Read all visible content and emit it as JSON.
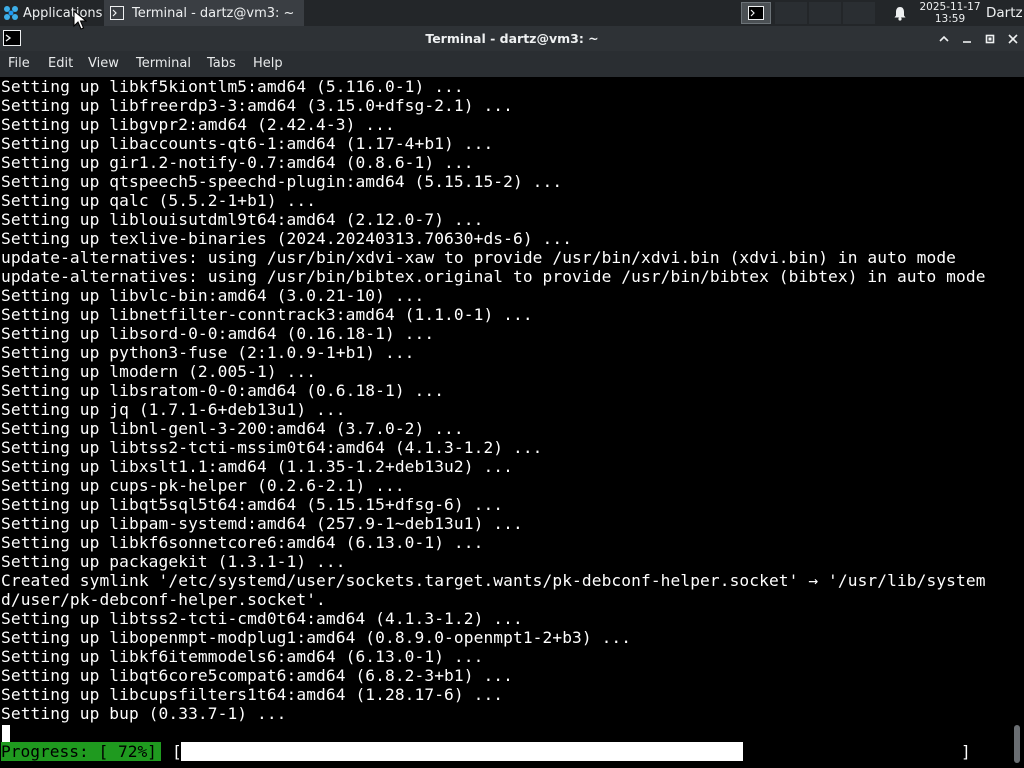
{
  "panel": {
    "apps_label": "Applications",
    "task_label": "Terminal - dartz@vm3: ~",
    "clock_date": "2025-11-17",
    "clock_time": "13:59",
    "user": "Dartz"
  },
  "window": {
    "title": "Terminal - dartz@vm3: ~"
  },
  "menu": {
    "file": "File",
    "edit": "Edit",
    "view": "View",
    "terminal": "Terminal",
    "tabs": "Tabs",
    "help": "Help"
  },
  "terminal": {
    "lines": [
      "Setting up libkf5kiontlm5:amd64 (5.116.0-1) ...",
      "Setting up libfreerdp3-3:amd64 (3.15.0+dfsg-2.1) ...",
      "Setting up libgvpr2:amd64 (2.42.4-3) ...",
      "Setting up libaccounts-qt6-1:amd64 (1.17-4+b1) ...",
      "Setting up gir1.2-notify-0.7:amd64 (0.8.6-1) ...",
      "Setting up qtspeech5-speechd-plugin:amd64 (5.15.15-2) ...",
      "Setting up qalc (5.5.2-1+b1) ...",
      "Setting up liblouisutdml9t64:amd64 (2.12.0-7) ...",
      "Setting up texlive-binaries (2024.20240313.70630+ds-6) ...",
      "update-alternatives: using /usr/bin/xdvi-xaw to provide /usr/bin/xdvi.bin (xdvi.bin) in auto mode",
      "update-alternatives: using /usr/bin/bibtex.original to provide /usr/bin/bibtex (bibtex) in auto mode",
      "Setting up libvlc-bin:amd64 (3.0.21-10) ...",
      "Setting up libnetfilter-conntrack3:amd64 (1.1.0-1) ...",
      "Setting up libsord-0-0:amd64 (0.16.18-1) ...",
      "Setting up python3-fuse (2:1.0.9-1+b1) ...",
      "Setting up lmodern (2.005-1) ...",
      "Setting up libsratom-0-0:amd64 (0.6.18-1) ...",
      "Setting up jq (1.7.1-6+deb13u1) ...",
      "Setting up libnl-genl-3-200:amd64 (3.7.0-2) ...",
      "Setting up libtss2-tcti-mssim0t64:amd64 (4.1.3-1.2) ...",
      "Setting up libxslt1.1:amd64 (1.1.35-1.2+deb13u2) ...",
      "Setting up cups-pk-helper (0.2.6-2.1) ...",
      "Setting up libqt5sql5t64:amd64 (5.15.15+dfsg-6) ...",
      "Setting up libpam-systemd:amd64 (257.9-1~deb13u1) ...",
      "Setting up libkf6sonnetcore6:amd64 (6.13.0-1) ...",
      "Setting up packagekit (1.3.1-1) ...",
      "Created symlink '/etc/systemd/user/sockets.target.wants/pk-debconf-helper.socket' → '/usr/lib/system",
      "d/user/pk-debconf-helper.socket'.",
      "Setting up libtss2-tcti-cmd0t64:amd64 (4.1.3-1.2) ...",
      "Setting up libopenmpt-modplug1:amd64 (0.8.9.0-openmpt1-2+b3) ...",
      "Setting up libkf6itemmodels6:amd64 (6.13.0-1) ...",
      "Setting up libqt6core5compat6:amd64 (6.8.2-3+b1) ...",
      "Setting up libcupsfilters1t64:amd64 (1.28.17-6) ...",
      "Setting up bup (0.33.7-1) ..."
    ],
    "progress_label": "Progress: [ 72%]",
    "progress_percent": 72,
    "bracket_open": "[",
    "bracket_close": "]"
  },
  "icons": {
    "apps": "app-menu-icon",
    "terminal": "terminal-icon",
    "bell": "bell-icon"
  },
  "colors": {
    "progress_green": "#1f9a1f",
    "panel_bg": "#232629"
  }
}
